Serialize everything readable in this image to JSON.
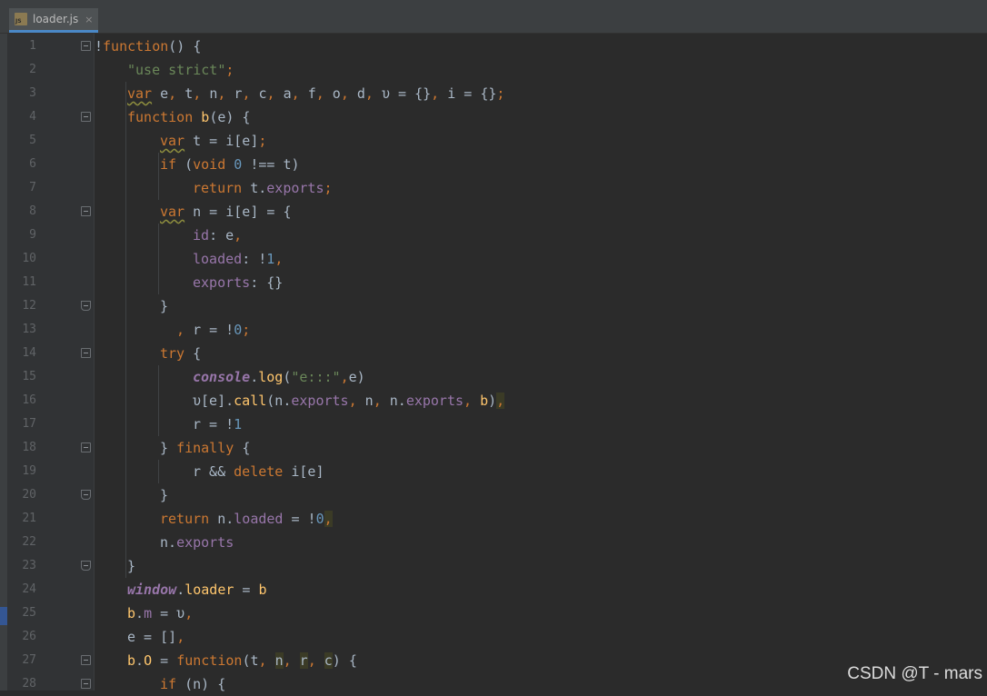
{
  "tab": {
    "label": "loader.js",
    "icon": "js-file-icon",
    "close": "×",
    "js_badge": "JS"
  },
  "line_numbers": [
    "1",
    "2",
    "3",
    "4",
    "5",
    "6",
    "7",
    "8",
    "9",
    "10",
    "11",
    "12",
    "13",
    "14",
    "15",
    "16",
    "17",
    "18",
    "19",
    "20",
    "21",
    "22",
    "23",
    "24",
    "25",
    "26",
    "27",
    "28"
  ],
  "code": [
    [
      {
        "t": "!",
        "c": "par"
      },
      {
        "t": "function",
        "c": "kw"
      },
      {
        "t": "() {",
        "c": "par"
      }
    ],
    [
      {
        "t": "\"use strict\"",
        "c": "str"
      },
      {
        "t": ";",
        "c": "kw"
      }
    ],
    [
      {
        "t": "var",
        "c": "kw",
        "w": 1
      },
      {
        "t": " e",
        "c": "par"
      },
      {
        "t": ", ",
        "c": "kw"
      },
      {
        "t": "t",
        "c": "par"
      },
      {
        "t": ", ",
        "c": "kw"
      },
      {
        "t": "n",
        "c": "par"
      },
      {
        "t": ", ",
        "c": "kw"
      },
      {
        "t": "r",
        "c": "par"
      },
      {
        "t": ", ",
        "c": "kw"
      },
      {
        "t": "c",
        "c": "par"
      },
      {
        "t": ", ",
        "c": "kw"
      },
      {
        "t": "a",
        "c": "par"
      },
      {
        "t": ", ",
        "c": "kw"
      },
      {
        "t": "f",
        "c": "par"
      },
      {
        "t": ", ",
        "c": "kw"
      },
      {
        "t": "o",
        "c": "par"
      },
      {
        "t": ", ",
        "c": "kw"
      },
      {
        "t": "d",
        "c": "par"
      },
      {
        "t": ", ",
        "c": "kw"
      },
      {
        "t": "υ = {}",
        "c": "par"
      },
      {
        "t": ", ",
        "c": "kw"
      },
      {
        "t": "i = {}",
        "c": "par"
      },
      {
        "t": ";",
        "c": "kw"
      }
    ],
    [
      {
        "t": "function ",
        "c": "kw"
      },
      {
        "t": "b",
        "c": "fn"
      },
      {
        "t": "(e) {",
        "c": "par"
      }
    ],
    [
      {
        "t": "var",
        "c": "kw",
        "w": 1
      },
      {
        "t": " t = i[e]",
        "c": "par"
      },
      {
        "t": ";",
        "c": "kw"
      }
    ],
    [
      {
        "t": "if ",
        "c": "kw"
      },
      {
        "t": "(",
        "c": "par"
      },
      {
        "t": "void ",
        "c": "kw"
      },
      {
        "t": "0",
        "c": "num"
      },
      {
        "t": " !== t)",
        "c": "par"
      }
    ],
    [
      {
        "t": "return ",
        "c": "kw"
      },
      {
        "t": "t.",
        "c": "par"
      },
      {
        "t": "exports",
        "c": "prop"
      },
      {
        "t": ";",
        "c": "kw"
      }
    ],
    [
      {
        "t": "var",
        "c": "kw",
        "w": 1
      },
      {
        "t": " n = i[e] = {",
        "c": "par"
      }
    ],
    [
      {
        "t": "id",
        "c": "prop"
      },
      {
        "t": ": e",
        "c": "par"
      },
      {
        "t": ",",
        "c": "kw"
      }
    ],
    [
      {
        "t": "loaded",
        "c": "prop"
      },
      {
        "t": ": !",
        "c": "par"
      },
      {
        "t": "1",
        "c": "num"
      },
      {
        "t": ",",
        "c": "kw"
      }
    ],
    [
      {
        "t": "exports",
        "c": "prop"
      },
      {
        "t": ": {}",
        "c": "par"
      }
    ],
    [
      {
        "t": "}",
        "c": "par"
      }
    ],
    [
      {
        "t": ", ",
        "c": "kw"
      },
      {
        "t": "r = !",
        "c": "par"
      },
      {
        "t": "0",
        "c": "num"
      },
      {
        "t": ";",
        "c": "kw"
      }
    ],
    [
      {
        "t": "try ",
        "c": "kw"
      },
      {
        "t": "{",
        "c": "par"
      }
    ],
    [
      {
        "t": "console",
        "c": "glob"
      },
      {
        "t": ".",
        "c": "par"
      },
      {
        "t": "log",
        "c": "fn"
      },
      {
        "t": "(",
        "c": "par"
      },
      {
        "t": "\"e:::\"",
        "c": "str"
      },
      {
        "t": ",",
        "c": "kw"
      },
      {
        "t": "e)",
        "c": "par"
      }
    ],
    [
      {
        "t": "υ[e].",
        "c": "par"
      },
      {
        "t": "call",
        "c": "fn"
      },
      {
        "t": "(n.",
        "c": "par"
      },
      {
        "t": "exports",
        "c": "prop"
      },
      {
        "t": ", ",
        "c": "kw"
      },
      {
        "t": "n",
        "c": "par"
      },
      {
        "t": ", ",
        "c": "kw"
      },
      {
        "t": "n.",
        "c": "par"
      },
      {
        "t": "exports",
        "c": "prop"
      },
      {
        "t": ", ",
        "c": "kw"
      },
      {
        "t": "b",
        "c": "fn"
      },
      {
        "t": ")",
        "c": "par"
      },
      {
        "t": ",",
        "c": "kw",
        "h": 1
      }
    ],
    [
      {
        "t": "r = !",
        "c": "par"
      },
      {
        "t": "1",
        "c": "num"
      }
    ],
    [
      {
        "t": "} ",
        "c": "par"
      },
      {
        "t": "finally ",
        "c": "kw"
      },
      {
        "t": "{",
        "c": "par"
      }
    ],
    [
      {
        "t": "r && ",
        "c": "par"
      },
      {
        "t": "delete ",
        "c": "kw"
      },
      {
        "t": "i[e]",
        "c": "par"
      }
    ],
    [
      {
        "t": "}",
        "c": "par"
      }
    ],
    [
      {
        "t": "return ",
        "c": "kw"
      },
      {
        "t": "n.",
        "c": "par"
      },
      {
        "t": "loaded",
        "c": "prop"
      },
      {
        "t": " = !",
        "c": "par"
      },
      {
        "t": "0",
        "c": "num"
      },
      {
        "t": ",",
        "c": "kw",
        "h": 1
      }
    ],
    [
      {
        "t": "n.",
        "c": "par"
      },
      {
        "t": "exports",
        "c": "prop"
      }
    ],
    [
      {
        "t": "}",
        "c": "par"
      }
    ],
    [
      {
        "t": "window",
        "c": "glob"
      },
      {
        "t": ".",
        "c": "par"
      },
      {
        "t": "loader",
        "c": "fn"
      },
      {
        "t": " = ",
        "c": "par"
      },
      {
        "t": "b",
        "c": "fn"
      }
    ],
    [
      {
        "t": "b",
        "c": "fn"
      },
      {
        "t": ".",
        "c": "par"
      },
      {
        "t": "m",
        "c": "prop"
      },
      {
        "t": " = υ",
        "c": "par"
      },
      {
        "t": ",",
        "c": "kw"
      }
    ],
    [
      {
        "t": "e = []",
        "c": "par"
      },
      {
        "t": ",",
        "c": "kw"
      }
    ],
    [
      {
        "t": "b",
        "c": "fn"
      },
      {
        "t": ".",
        "c": "par"
      },
      {
        "t": "O",
        "c": "fn"
      },
      {
        "t": " = ",
        "c": "par"
      },
      {
        "t": "function",
        "c": "kw"
      },
      {
        "t": "(t",
        "c": "par"
      },
      {
        "t": ", ",
        "c": "kw"
      },
      {
        "t": "n",
        "c": "par",
        "h": 1
      },
      {
        "t": ", ",
        "c": "kw"
      },
      {
        "t": "r",
        "c": "par",
        "h": 1
      },
      {
        "t": ", ",
        "c": "kw"
      },
      {
        "t": "c",
        "c": "par",
        "h": 1
      },
      {
        "t": ") {",
        "c": "par"
      }
    ],
    [
      {
        "t": "if ",
        "c": "kw"
      },
      {
        "t": "(n) {",
        "c": "par"
      }
    ]
  ],
  "watermark": "CSDN @T - mars"
}
